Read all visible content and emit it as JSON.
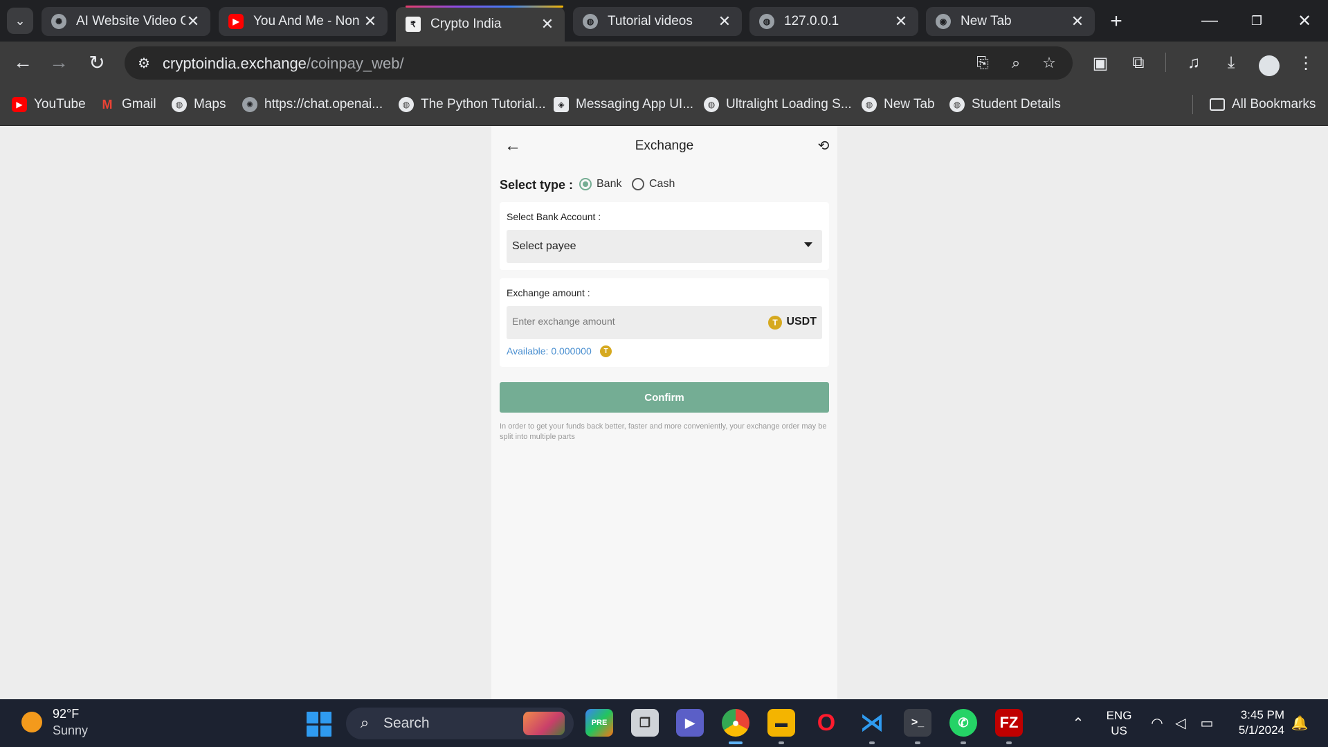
{
  "browser": {
    "tabs": [
      {
        "title": "AI Website Video C",
        "favicon": "openai-icon"
      },
      {
        "title": "You And Me - Non",
        "favicon": "youtube-icon"
      },
      {
        "title": "Crypto India",
        "favicon": "rupee-icon",
        "active": true
      },
      {
        "title": "Tutorial videos",
        "favicon": "globe-icon"
      },
      {
        "title": "127.0.0.1",
        "favicon": "globe-icon"
      },
      {
        "title": "New Tab",
        "favicon": "chrome-icon"
      }
    ],
    "url_domain": "cryptoindia.exchange",
    "url_path": "/coinpay_web/",
    "bookmarks": [
      {
        "label": "YouTube"
      },
      {
        "label": "Gmail"
      },
      {
        "label": "Maps"
      },
      {
        "label": "https://chat.openai..."
      },
      {
        "label": "The Python Tutorial..."
      },
      {
        "label": "Messaging App UI..."
      },
      {
        "label": "Ultralight Loading S..."
      },
      {
        "label": "New Tab"
      },
      {
        "label": "Student Details"
      }
    ],
    "all_bookmarks": "All Bookmarks"
  },
  "page": {
    "title": "Exchange",
    "select_type_label": "Select type :",
    "type_options": [
      {
        "label": "Bank",
        "selected": true
      },
      {
        "label": "Cash",
        "selected": false
      }
    ],
    "bank_account_label": "Select Bank Account :",
    "payee_select_value": "Select payee",
    "amount_label": "Exchange amount :",
    "amount_placeholder": "Enter exchange amount",
    "currency": "USDT",
    "available_text": "Available: 0.000000",
    "confirm_label": "Confirm",
    "note": "In order to get your funds back better, faster and more conveniently, your exchange order may be split into multiple parts"
  },
  "taskbar": {
    "temperature": "92°F",
    "condition": "Sunny",
    "search_label": "Search",
    "lang_top": "ENG",
    "lang_bottom": "US",
    "time": "3:45 PM",
    "date": "5/1/2024"
  },
  "colors": {
    "accent_green": "#74ad94",
    "link_blue": "#4a8fd0",
    "coin_gold": "#d6a91f"
  }
}
